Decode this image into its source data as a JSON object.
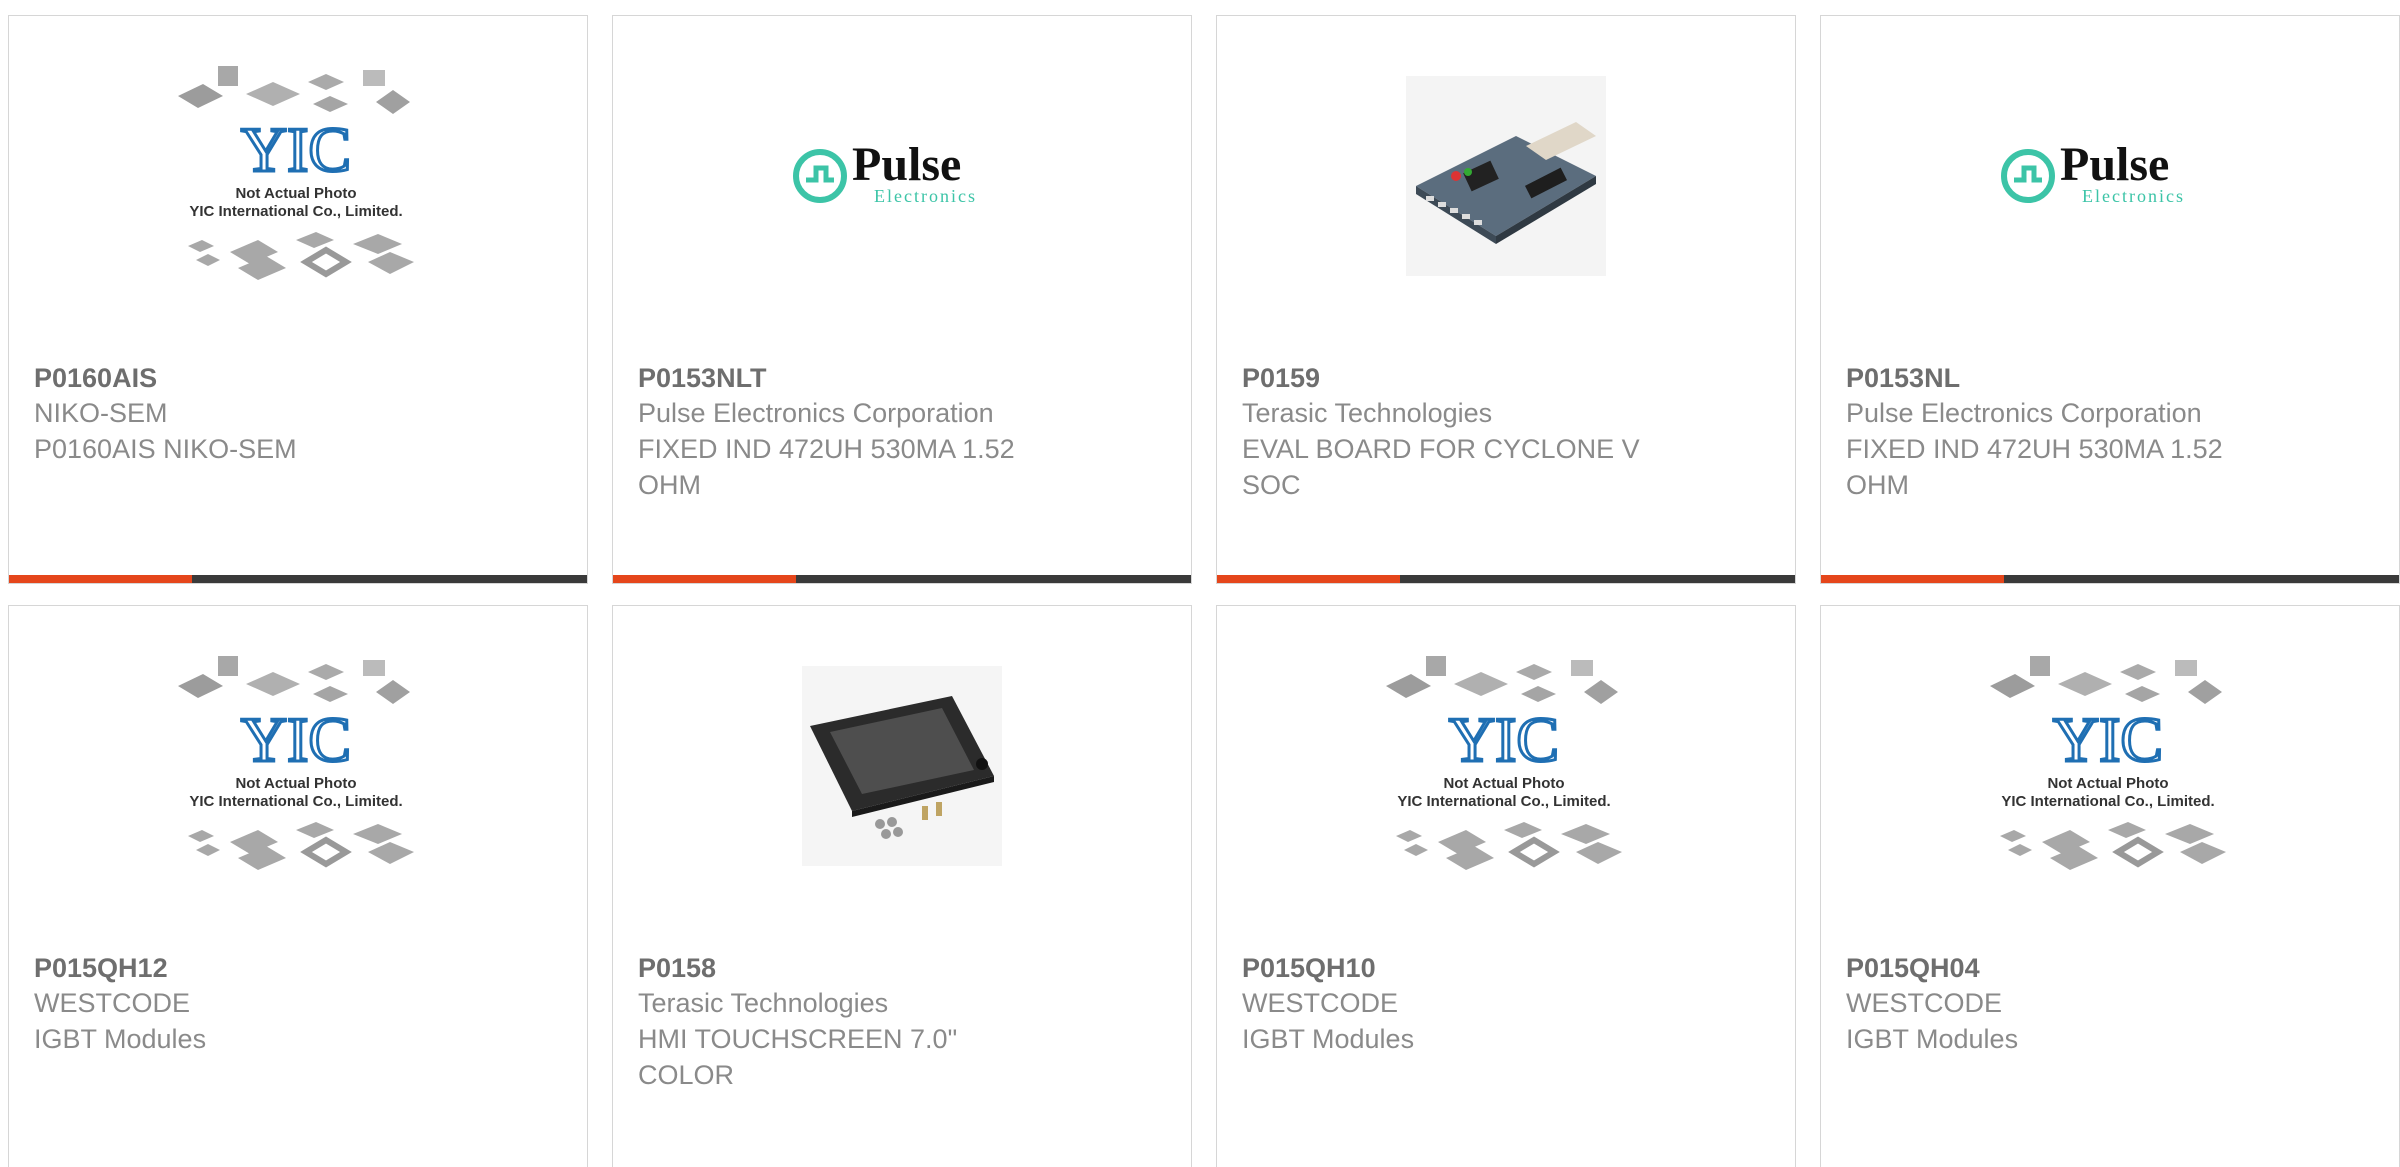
{
  "accent_color": "#e5461b",
  "bar_color": "#3a3a3a",
  "products": [
    {
      "part": "P0160AIS",
      "manufacturer": "NIKO-SEM",
      "description": "P0160AIS NIKO-SEM",
      "image": "yic-placeholder",
      "image_caption": [
        "Not Actual Photo",
        "YIC International Co., Limited."
      ]
    },
    {
      "part": "P0153NLT",
      "manufacturer": "Pulse Electronics Corporation",
      "description": "FIXED IND 472UH 530MA 1.52 OHM",
      "image": "pulse-logo",
      "logo_main": "Pulse",
      "logo_sub": "Electronics"
    },
    {
      "part": "P0159",
      "manufacturer": "Terasic Technologies",
      "description": "EVAL BOARD FOR CYCLONE V SOC",
      "image": "eval-board-photo"
    },
    {
      "part": "P0153NL",
      "manufacturer": "Pulse Electronics Corporation",
      "description": "FIXED IND 472UH 530MA 1.52 OHM",
      "image": "pulse-logo",
      "logo_main": "Pulse",
      "logo_sub": "Electronics"
    },
    {
      "part": "P015QH12",
      "manufacturer": "WESTCODE",
      "description": "IGBT Modules",
      "image": "yic-placeholder",
      "image_caption": [
        "Not Actual Photo",
        "YIC International Co., Limited."
      ]
    },
    {
      "part": "P0158",
      "manufacturer": "Terasic Technologies",
      "description": "HMI TOUCHSCREEN 7.0\" COLOR",
      "image": "touchscreen-photo"
    },
    {
      "part": "P015QH10",
      "manufacturer": "WESTCODE",
      "description": "IGBT Modules",
      "image": "yic-placeholder",
      "image_caption": [
        "Not Actual Photo",
        "YIC International Co., Limited."
      ]
    },
    {
      "part": "P015QH04",
      "manufacturer": "WESTCODE",
      "description": "IGBT Modules",
      "image": "yic-placeholder",
      "image_caption": [
        "Not Actual Photo",
        "YIC International Co., Limited."
      ]
    }
  ]
}
